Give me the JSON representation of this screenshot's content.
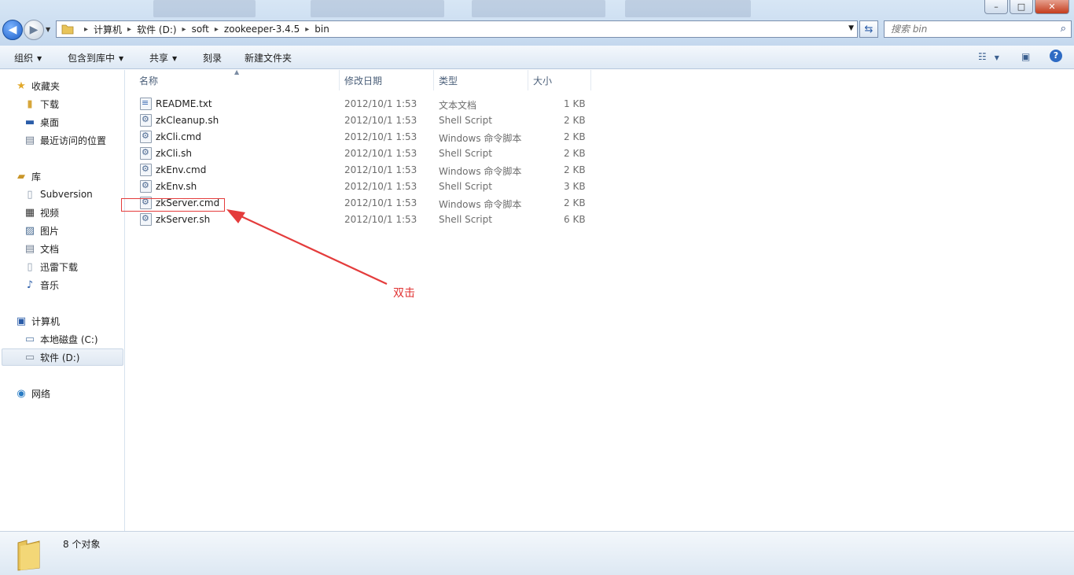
{
  "window": {
    "controls": {
      "minimize": "–",
      "maximize": "□",
      "close": "✕"
    }
  },
  "address": {
    "crumbs": [
      "计算机",
      "软件 (D:)",
      "soft",
      "zookeeper-3.4.5",
      "bin"
    ]
  },
  "search": {
    "placeholder": "搜索 bin"
  },
  "toolbar": {
    "organize": "组织",
    "include_library": "包含到库中",
    "share": "共享",
    "burn": "刻录",
    "new_folder": "新建文件夹"
  },
  "sidebar": {
    "favorites": "收藏夹",
    "downloads": "下载",
    "desktop": "桌面",
    "recent": "最近访问的位置",
    "libraries": "库",
    "subversion": "Subversion",
    "videos": "视频",
    "pictures": "图片",
    "documents": "文档",
    "xunlei": "迅雷下载",
    "music": "音乐",
    "computer": "计算机",
    "drive_c": "本地磁盘 (C:)",
    "drive_d": "软件 (D:)",
    "network": "网络"
  },
  "columns": {
    "name": "名称",
    "date": "修改日期",
    "type": "类型",
    "size": "大小"
  },
  "files": [
    {
      "name": "README.txt",
      "date": "2012/10/1 1:53",
      "type": "文本文档",
      "size": "1 KB"
    },
    {
      "name": "zkCleanup.sh",
      "date": "2012/10/1 1:53",
      "type": "Shell Script",
      "size": "2 KB"
    },
    {
      "name": "zkCli.cmd",
      "date": "2012/10/1 1:53",
      "type": "Windows 命令脚本",
      "size": "2 KB"
    },
    {
      "name": "zkCli.sh",
      "date": "2012/10/1 1:53",
      "type": "Shell Script",
      "size": "2 KB"
    },
    {
      "name": "zkEnv.cmd",
      "date": "2012/10/1 1:53",
      "type": "Windows 命令脚本",
      "size": "2 KB"
    },
    {
      "name": "zkEnv.sh",
      "date": "2012/10/1 1:53",
      "type": "Shell Script",
      "size": "3 KB"
    },
    {
      "name": "zkServer.cmd",
      "date": "2012/10/1 1:53",
      "type": "Windows 命令脚本",
      "size": "2 KB"
    },
    {
      "name": "zkServer.sh",
      "date": "2012/10/1 1:53",
      "type": "Shell Script",
      "size": "6 KB"
    }
  ],
  "annotation": {
    "text": "双击",
    "color": "#e03030"
  },
  "status": {
    "count": "8 个对象"
  }
}
